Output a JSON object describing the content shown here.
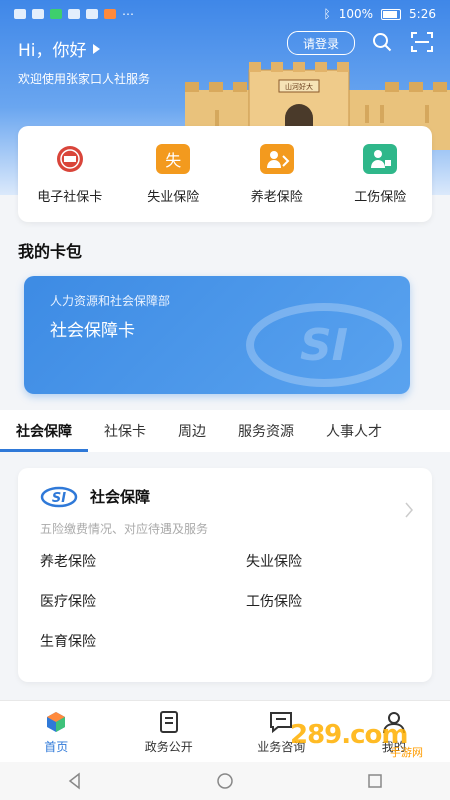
{
  "status_bar": {
    "battery": "100%",
    "time": "5:26"
  },
  "header": {
    "greeting": "Hi，你好",
    "subtitle": "欢迎使用张家口人社服务",
    "login_label": "请登录",
    "wall_plaque": "山河好大"
  },
  "quick_actions": [
    {
      "label": "电子社保卡",
      "icon": "social-security-card-icon",
      "color": "#d9453a"
    },
    {
      "label": "失业保险",
      "icon": "unemployment-icon",
      "glyph": "失",
      "color": "#f39a1e"
    },
    {
      "label": "养老保险",
      "icon": "pension-icon",
      "color": "#f39a1e"
    },
    {
      "label": "工伤保险",
      "icon": "injury-insurance-icon",
      "color": "#2fb78a"
    }
  ],
  "card_pack": {
    "title": "我的卡包",
    "card": {
      "org": "人力资源和社会保障部",
      "name": "社会保障卡"
    }
  },
  "tabs": [
    "社会保障",
    "社保卡",
    "周边",
    "服务资源",
    "人事人才"
  ],
  "active_tab": "社会保障",
  "panel": {
    "title": "社会保障",
    "subtitle": "五险缴费情况、对应待遇及服务",
    "items": [
      "养老保险",
      "失业保险",
      "医疗保险",
      "工伤保险",
      "生育保险"
    ]
  },
  "bottom_nav": [
    {
      "label": "首页",
      "icon": "home-icon",
      "active": true
    },
    {
      "label": "政务公开",
      "icon": "document-icon",
      "active": false
    },
    {
      "label": "业务咨询",
      "icon": "chat-icon",
      "active": false
    },
    {
      "label": "我的",
      "icon": "profile-icon",
      "active": false
    }
  ],
  "watermark": {
    "brand": "289.com",
    "sub": "手游网"
  },
  "colors": {
    "primary": "#2f79d8",
    "accent_orange": "#f39a1e",
    "accent_green": "#2fb78a",
    "card_blue": "#3d8be4"
  }
}
